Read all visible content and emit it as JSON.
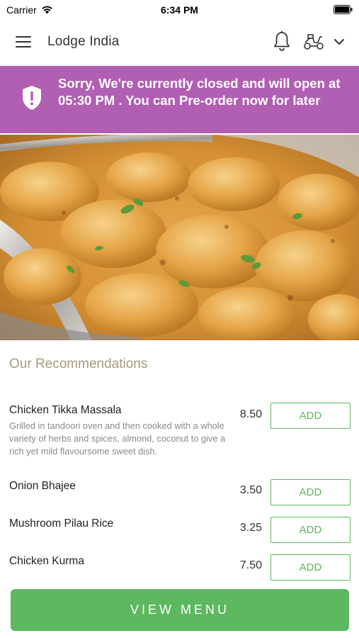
{
  "status_bar": {
    "carrier": "Carrier",
    "time": "6:34 PM"
  },
  "header": {
    "title": "Lodge India",
    "icons": [
      "menu-icon",
      "bell-icon",
      "delivery-scooter-icon",
      "chevron-down-icon"
    ]
  },
  "banner": {
    "text": "Sorry, We're currently closed and will open at 05:30 PM . You can Pre-order now for later",
    "icon": "shield-alert-icon",
    "color": "#b15fb3"
  },
  "recommendations": {
    "title": "Our Recommendations",
    "items": [
      {
        "name": "Chicken Tikka Massala",
        "description": "Grilled in tandoori oven and then cooked with a whole variety of herbs and spices, almond, coconut to give a rich yet mild flavoursome sweet dish.",
        "price": "8.50",
        "button": "ADD"
      },
      {
        "name": "Onion Bhajee",
        "description": "",
        "price": "3.50",
        "button": "ADD"
      },
      {
        "name": "Mushroom Pilau Rice",
        "description": "",
        "price": "3.25",
        "button": "ADD"
      },
      {
        "name": "Chicken Kurma",
        "description": "",
        "price": "7.50",
        "button": "ADD"
      }
    ]
  },
  "footer": {
    "view_menu_label": "VIEW MENU"
  },
  "colors": {
    "accent": "#5db85f",
    "banner": "#b15fb3",
    "section_title": "#a79a7c"
  }
}
